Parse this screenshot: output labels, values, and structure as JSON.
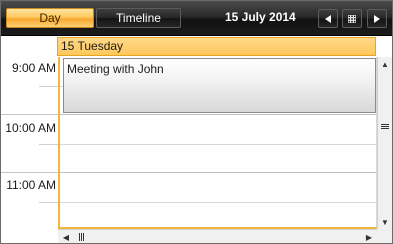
{
  "toolbar": {
    "views": [
      {
        "label": "Day",
        "selected": true
      },
      {
        "label": "Timeline",
        "selected": false
      }
    ],
    "current_date": "15 July 2014",
    "nav_icons": [
      "triangle-left-icon",
      "calendar-grid-icon",
      "triangle-right-icon"
    ]
  },
  "day_header": {
    "label": "15 Tuesday"
  },
  "time_ruler": {
    "labels": [
      "9:00 AM",
      "10:00 AM",
      "11:00 AM"
    ]
  },
  "appointments": [
    {
      "subject": "Meeting with John"
    }
  ],
  "colors": {
    "accent": "#f3b63c",
    "toolbar_dark": "#1c1c1c",
    "selected_view": "#ffc95d"
  }
}
